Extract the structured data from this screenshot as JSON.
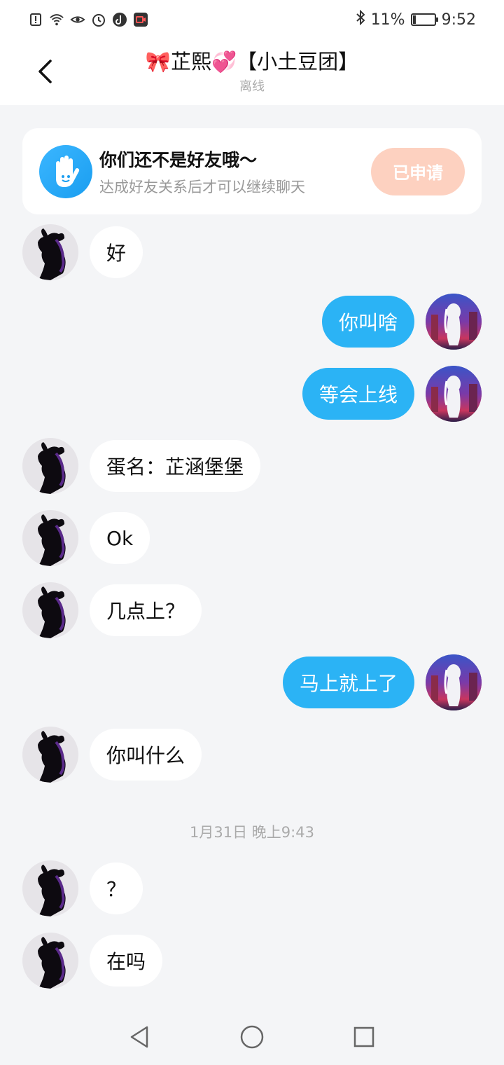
{
  "status_bar": {
    "bluetooth_icon": "bluetooth-icon",
    "battery_percent": "11%",
    "time": "9:52",
    "battery_level": 0.11
  },
  "header": {
    "back_icon": "chevron-left-icon",
    "title": "🎀芷熙💞【小土豆团】",
    "subtitle": "离线"
  },
  "friend_banner": {
    "title": "你们还不是好友哦～",
    "description": "达成好友关系后才可以继续聊天",
    "button_label": "已申请",
    "icon": "waving-hand-icon"
  },
  "messages": [
    {
      "side": "them",
      "text": "好"
    },
    {
      "side": "me",
      "text": "你叫啥"
    },
    {
      "side": "me",
      "text": "等会上线"
    },
    {
      "side": "them",
      "text": "蛋名：芷涵堡堡"
    },
    {
      "side": "them",
      "text": "Ok"
    },
    {
      "side": "them",
      "text": "几点上？"
    },
    {
      "side": "me",
      "text": "马上就上了"
    },
    {
      "side": "them",
      "text": "你叫什么"
    },
    {
      "side": "timestamp",
      "text": "1月31日 晚上9:43"
    },
    {
      "side": "them",
      "text": "？"
    },
    {
      "side": "them",
      "text": "在吗"
    }
  ],
  "colors": {
    "my_bubble": "#2bb3f5",
    "their_bubble": "#ffffff",
    "applied_button": "#fdd1c0",
    "background": "#f4f5f7"
  },
  "nav": {
    "back_icon": "triangle-back-icon",
    "home_icon": "circle-home-icon",
    "recents_icon": "square-recents-icon"
  }
}
